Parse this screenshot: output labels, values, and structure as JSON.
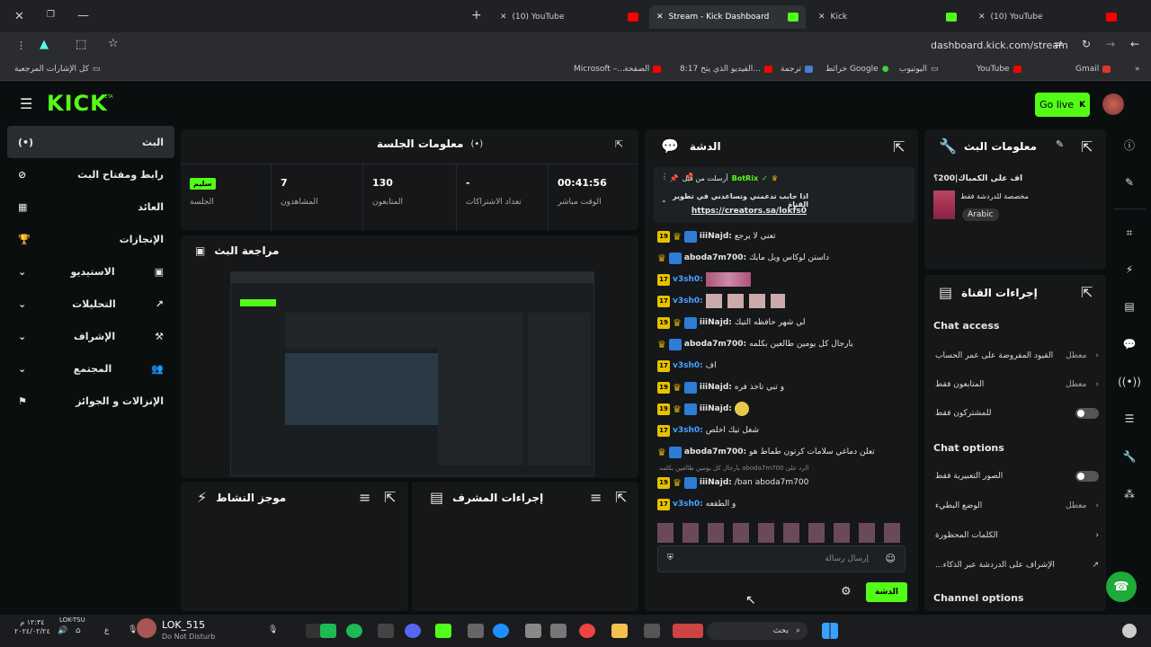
{
  "browser": {
    "tabs": [
      {
        "label": "(10) YouTube"
      },
      {
        "label": "Stream - Kick Dashboard"
      },
      {
        "label": "Kick"
      },
      {
        "label": "(10) YouTube"
      }
    ],
    "url": "dashboard.kick.com/stream",
    "bookmarks": [
      "كل الإشارات المرجعية",
      "Gmail",
      "YouTube",
      "اليوتيوب",
      "خرائط Google",
      "ترجمة",
      "8:17 الفيديو الذي يتح...",
      "الصفحة",
      "Microsoft –..."
    ]
  },
  "header": {
    "logo": "KICK",
    "beta": "BETA",
    "go_live": "Go live"
  },
  "sidebar": {
    "items": [
      {
        "label": "البث"
      },
      {
        "label": "رابط ومفتاح البث"
      },
      {
        "label": "العائد"
      },
      {
        "label": "الإنجازات"
      },
      {
        "label": "الاستيديو"
      },
      {
        "label": "التحليلات"
      },
      {
        "label": "الإشراف"
      },
      {
        "label": "المجتمع"
      },
      {
        "label": "الإنزالات و الجوائز"
      }
    ]
  },
  "session": {
    "title": "معلومات الجلسة",
    "stats": [
      {
        "value": "سليم",
        "label": "الجلسة"
      },
      {
        "value": "7",
        "label": "المشاهدون"
      },
      {
        "value": "130",
        "label": "المتابعون"
      },
      {
        "value": "-",
        "label": "تعداد الاشتراكات"
      },
      {
        "value": "00:41:56",
        "label": "الوقت مباشر"
      }
    ]
  },
  "preview": {
    "title": "مراجعة البث"
  },
  "activity": {
    "title": "موجز النشاط"
  },
  "modactions": {
    "title": "إجراءات المشرف"
  },
  "chat": {
    "title": "الدشة",
    "pinned": {
      "by": "أرسلت من قبل",
      "user": "BotRix",
      "text": "اذا حابب تدعمني وتساعدني في تطوير القناة",
      "link": "https://creators.sa/lokfs0"
    },
    "messages": [
      {
        "user": "iiiNajd:",
        "text": "تعني لا يرجع",
        "b17": "19"
      },
      {
        "user": "aboda7m700:",
        "text": "داستن لوكاس ويل مايك",
        "b17": ""
      },
      {
        "user": "v3sh0:",
        "text": "",
        "b17": "17"
      },
      {
        "user": "v3sh0:",
        "text": "",
        "b17": "17"
      },
      {
        "user": "iiiNajd:",
        "text": "لي شهر حافظه التيك",
        "b17": "19"
      },
      {
        "user": "aboda7m700:",
        "text": "يارجال كل يومين طالعين بكلمه",
        "b17": ""
      },
      {
        "user": "v3sh0:",
        "text": "اف",
        "b17": "17"
      },
      {
        "user": "iiiNajd:",
        "text": "و تبي تاخذ فره",
        "b17": "19"
      },
      {
        "user": "iiiNajd:",
        "text": "",
        "b17": "19"
      },
      {
        "user": "v3sh0:",
        "text": "شغل تيك اخلص",
        "b17": "17"
      },
      {
        "user": "aboda7m700:",
        "text": "تعلن دماغي سلامات كرتون طماط هو",
        "b17": ""
      },
      {
        "user": "iiiNajd:",
        "text": "/ban aboda7m700",
        "b17": "19",
        "reply": "يارجال كل يومين طالعين بكلمه aboda7m700 الرد على"
      },
      {
        "user": "v3sh0:",
        "text": "و الطقعه",
        "b17": "17"
      }
    ],
    "input_placeholder": "إرسال رسالة",
    "send": "الدشة"
  },
  "streaminfo": {
    "title": "معلومات البث",
    "stream_title": "اف على الكمباك|200؟",
    "category": "مخصصة للدردشة فقط",
    "language": "Arabic"
  },
  "channel_actions": {
    "title": "إجراءات القناة",
    "chat_access": "Chat access",
    "rows_access": [
      {
        "label": "القيود المفروضة على عمر الحساب",
        "state": "معطل"
      },
      {
        "label": "المتابعون فقط",
        "state": "معطل"
      },
      {
        "label": "للمشتركون فقط",
        "state": ""
      }
    ],
    "chat_options": "Chat options",
    "rows_options": [
      {
        "label": "الصور التعبيرية فقط",
        "state": ""
      },
      {
        "label": "الوضع البطيء",
        "state": "معطل"
      },
      {
        "label": "الكلمات المحظورة",
        "state": ""
      },
      {
        "label": "...الإشراف على الدردشة عبر الذكاء",
        "state": ""
      }
    ],
    "channel_options": "Channel options"
  },
  "taskbar": {
    "user": "LOK_515",
    "status": "Do Not Disturb",
    "clock_top": "١٢:٣٤ م",
    "clock_bot": "٢٠٢٤/٠٢/٢٤",
    "search": "بحث",
    "tray_user": "LOK-TSU"
  },
  "colors": {
    "accent": "#53fc18",
    "bg": "#0b0e0f",
    "panel": "#151719"
  }
}
